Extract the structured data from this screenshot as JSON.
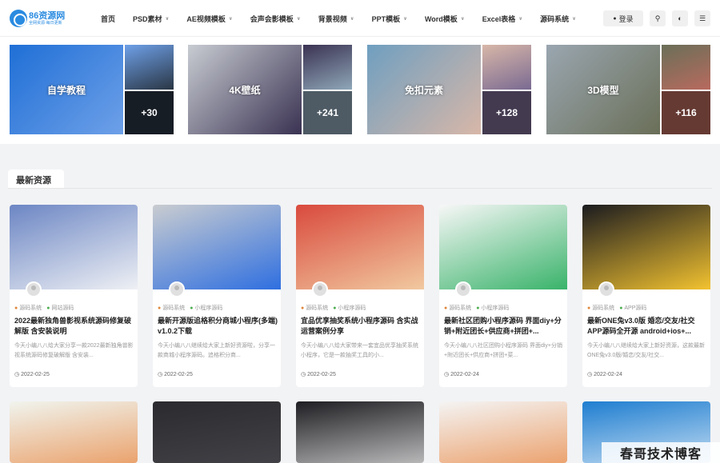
{
  "header": {
    "logo_title": "86资源网",
    "logo_sub": "全网资源·每日更新",
    "nav": [
      {
        "label": "首页",
        "has_dropdown": false
      },
      {
        "label": "PSD素材",
        "has_dropdown": true
      },
      {
        "label": "AE视频模板",
        "has_dropdown": true
      },
      {
        "label": "会声会影模板",
        "has_dropdown": true
      },
      {
        "label": "背景视频",
        "has_dropdown": true
      },
      {
        "label": "PPT模板",
        "has_dropdown": true
      },
      {
        "label": "Word模板",
        "has_dropdown": true
      },
      {
        "label": "Excel表格",
        "has_dropdown": true
      },
      {
        "label": "源码系统",
        "has_dropdown": true
      }
    ],
    "login_label": "登录",
    "icons": [
      "search-icon",
      "theme-toggle-icon",
      "menu-icon"
    ]
  },
  "categories": [
    {
      "label": "自学教程",
      "count": "+30",
      "colors": [
        "#1f6fd6",
        "#6ea0e8",
        "#2a3644"
      ]
    },
    {
      "label": "4K壁纸",
      "count": "+241",
      "colors": [
        "#c8ccd2",
        "#3a3252",
        "#8fa7b8"
      ]
    },
    {
      "label": "免扣元素",
      "count": "+128",
      "colors": [
        "#6f9fc0",
        "#d8b7a8",
        "#7a6a92"
      ]
    },
    {
      "label": "3D模型",
      "count": "+116",
      "colors": [
        "#9aa6b0",
        "#6a6f58",
        "#b86a5e"
      ]
    }
  ],
  "section_title": "最新资源",
  "cards": [
    {
      "tag1": "源码系统",
      "tag2": "网站源码",
      "title": "2022最新独角兽影视系统源码修复破解版 含安装说明",
      "desc": "今天小编八八给大家分享一款2022最新独角兽影视系统源码修复破解版 含安装...",
      "date": "2022-02-25",
      "colors": [
        "#6c86c4",
        "#eef0f4"
      ]
    },
    {
      "tag1": "源码系统",
      "tag2": "小程序源码",
      "title": "最新开源版追格积分商城小程序(多端) v1.0.2下载",
      "desc": "今天小编八八继续给大家上新好资源啦，分享一款商城小程序源码。追格积分商...",
      "date": "2022-02-25",
      "colors": [
        "#c9ccd0",
        "#2f6fe0"
      ]
    },
    {
      "tag1": "源码系统",
      "tag2": "小程序源码",
      "title": "宜品优享抽奖系统小程序源码 含实战运营案例分享",
      "desc": "今天小编八八给大家带来一套宜品优享抽奖系统小程序，它是一款抽奖工具的小...",
      "date": "2022-02-25",
      "colors": [
        "#d94a3d",
        "#f1c9a0"
      ]
    },
    {
      "tag1": "源码系统",
      "tag2": "小程序源码",
      "title": "最新社区团购小程序源码 界面diy+分销+附近团长+供应商+拼团+...",
      "desc": "今天小编八八社区团购小程序源码 界面diy+分销+附近团长+供应商+拼团+菜...",
      "date": "2022-02-24",
      "colors": [
        "#f7f7f7",
        "#39b36a"
      ]
    },
    {
      "tag1": "源码系统",
      "tag2": "APP源码",
      "title": "最新ONE兔v3.0版 婚恋/交友/社交APP源码全开源 android+ios+...",
      "desc": "今天小编八八继续给大家上新好资源，这款最新ONE兔v3.0版/婚恋/交友/社交...",
      "date": "2022-02-24",
      "colors": [
        "#1b1b1f",
        "#f2c230"
      ]
    }
  ],
  "bottom_cards": [
    {
      "colors": [
        "#f0f4ee",
        "#e8823a"
      ]
    },
    {
      "colors": [
        "#2b2b2f",
        "#4a4a50"
      ]
    },
    {
      "colors": [
        "#1e1e22",
        "#f5f5f5"
      ]
    },
    {
      "colors": [
        "#f4f4f4",
        "#e8823a"
      ]
    },
    {
      "colors": [
        "#1f7ed0",
        "#ffffff"
      ]
    }
  ],
  "watermark": "春哥技术博客"
}
